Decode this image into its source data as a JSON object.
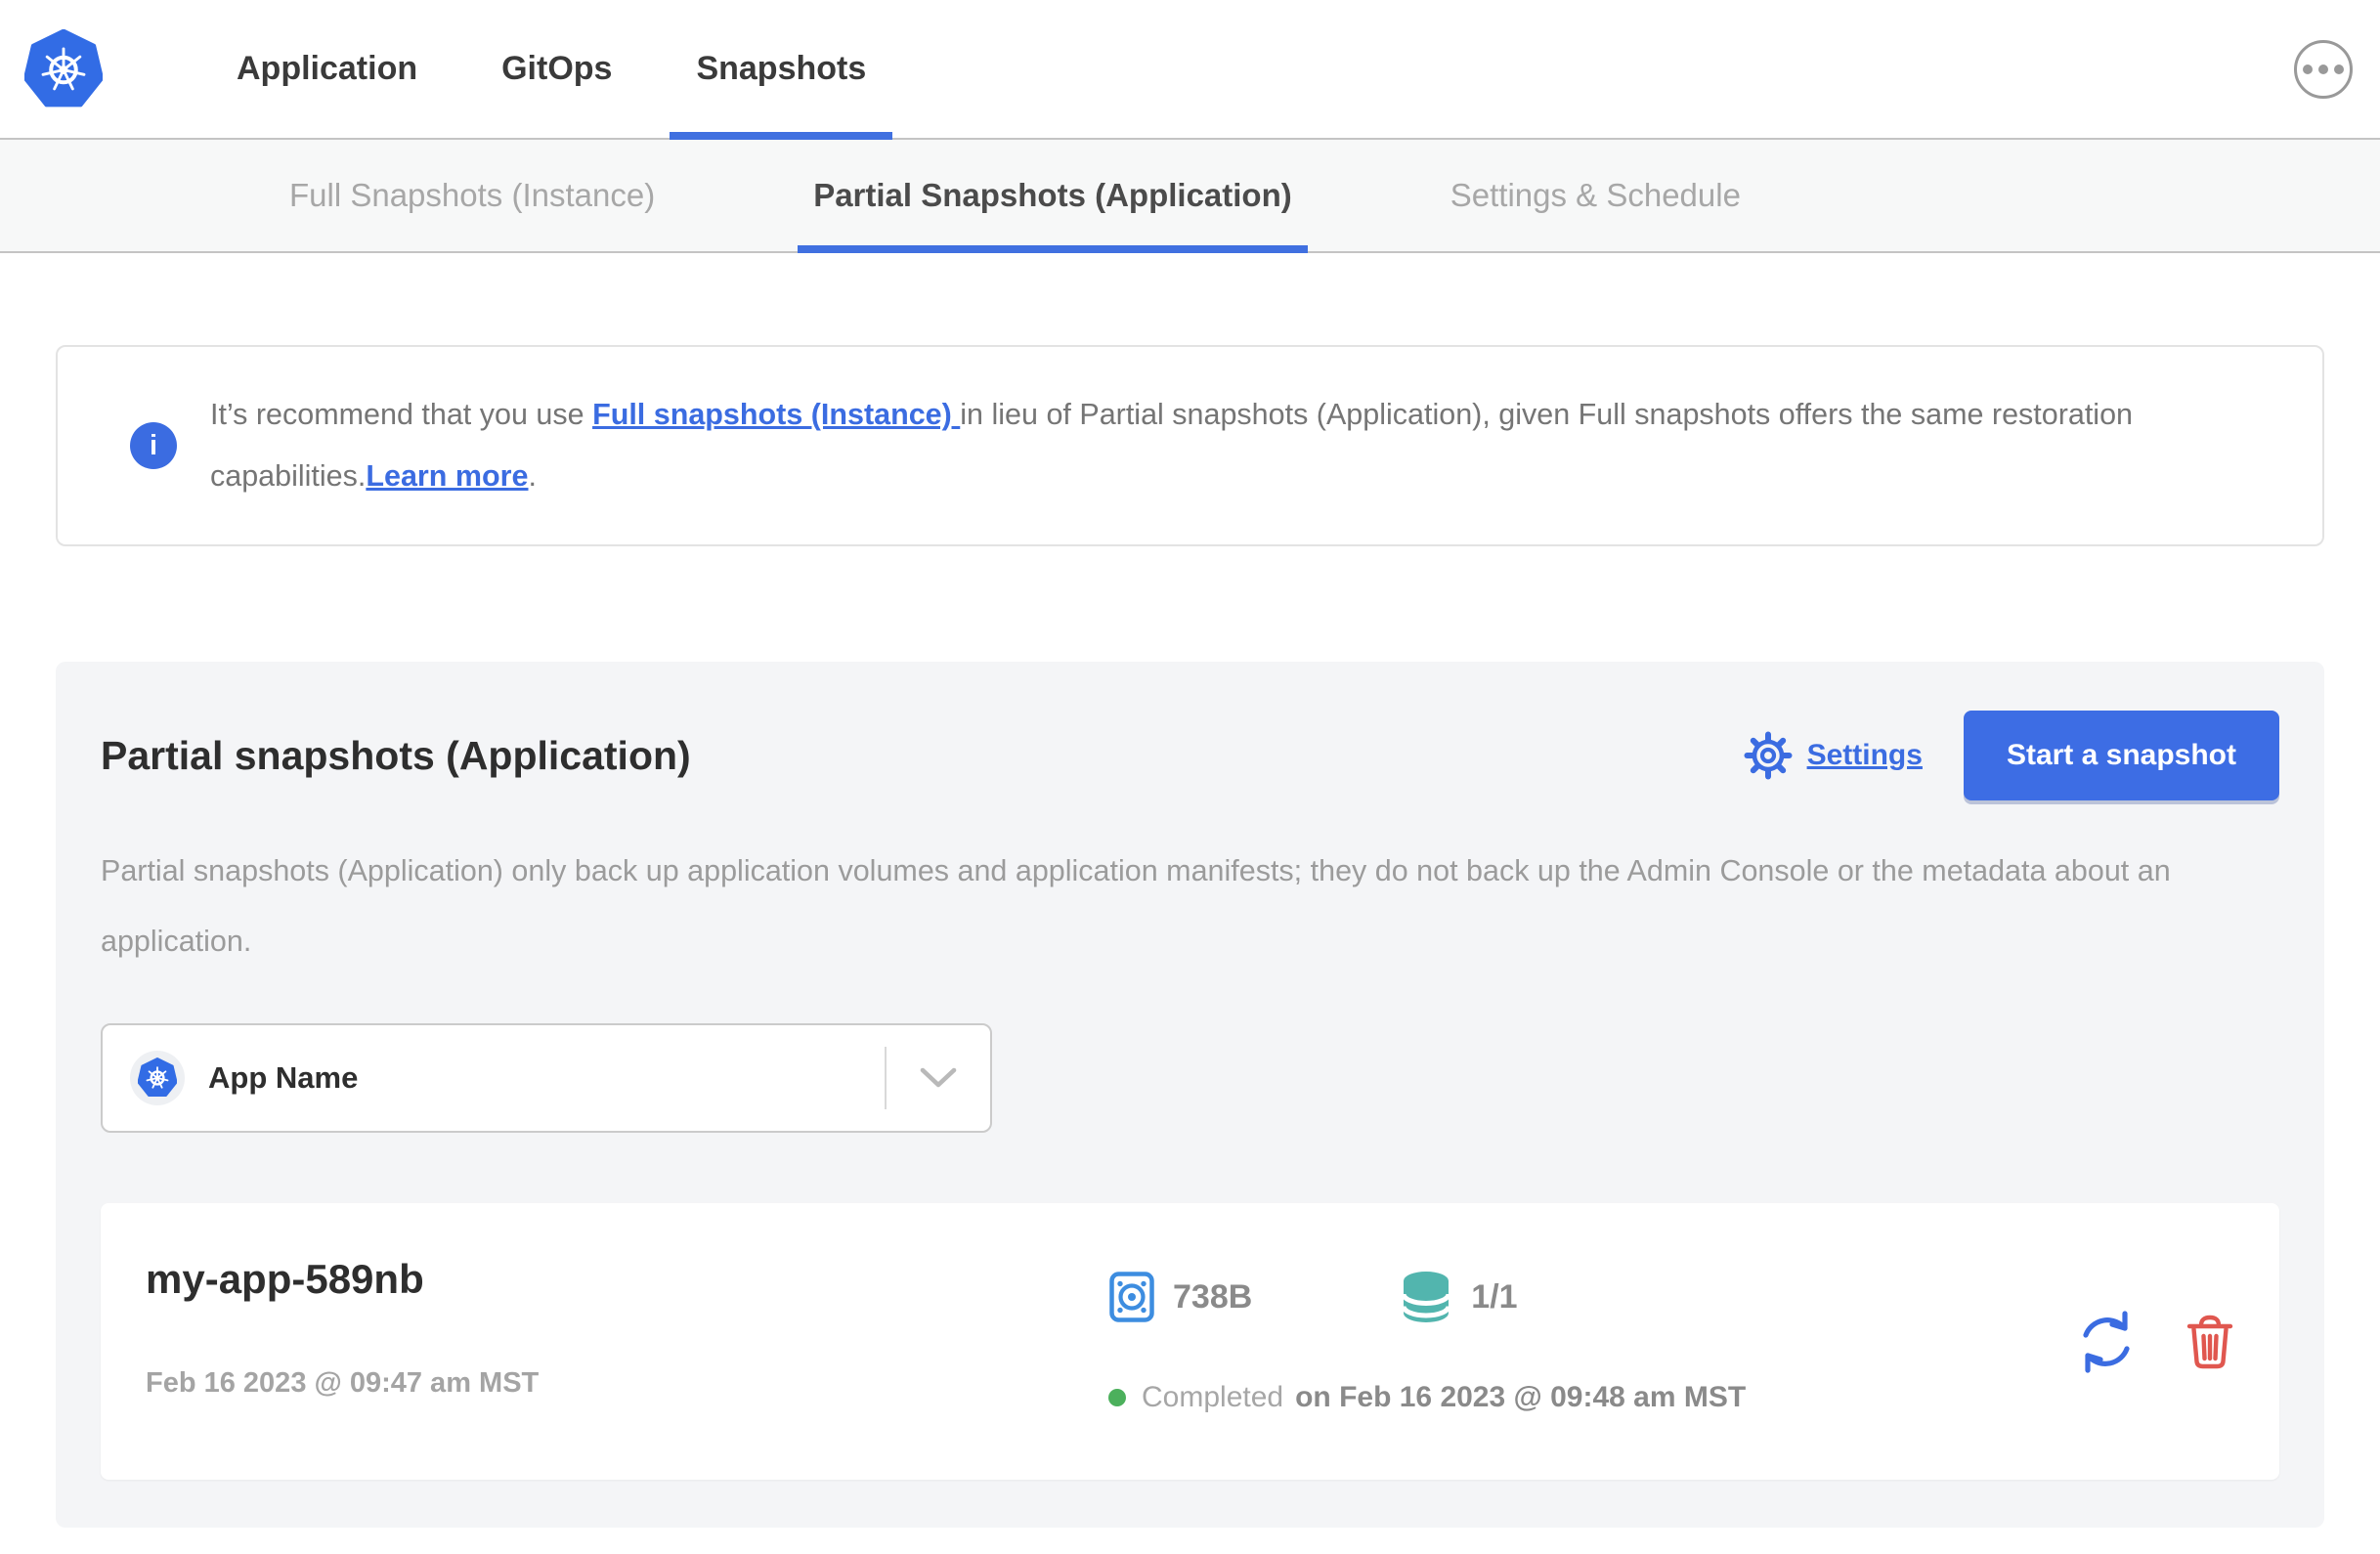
{
  "nav": {
    "items": [
      {
        "label": "Application"
      },
      {
        "label": "GitOps"
      },
      {
        "label": "Snapshots"
      }
    ]
  },
  "subnav": {
    "tabs": [
      {
        "label": "Full Snapshots (Instance)"
      },
      {
        "label": "Partial Snapshots (Application)"
      },
      {
        "label": "Settings & Schedule"
      }
    ]
  },
  "banner": {
    "text1": "It’s recommend that you use ",
    "link1": "Full snapshots (Instance) ",
    "text2": "in lieu of Partial snapshots (Application), given Full snapshots offers the same restoration capabilities.",
    "link2": "Learn more",
    "text3": "."
  },
  "main": {
    "title": "Partial snapshots (Application)",
    "settings_label": "Settings",
    "start_button_label": "Start a snapshot",
    "description": "Partial snapshots (Application) only back up application volumes and application manifests; they do not back up the Admin Console or the metadata about an application.",
    "app_selector": {
      "value": "App Name"
    },
    "snapshots": [
      {
        "name": "my-app-589nb",
        "created": "Feb 16 2023 @ 09:47 am MST",
        "size": "738B",
        "volumes": "1/1",
        "status": "Completed",
        "finished": "on Feb 16 2023 @ 09:48 am MST"
      }
    ]
  },
  "colors": {
    "accent_blue": "#3b6ce1",
    "button_blue": "#3d6de4",
    "k8s_blue": "#326ce5",
    "disk_blue": "#3d8de0",
    "teal": "#52b5ae",
    "red": "#e0574f",
    "green": "#4cb05c"
  }
}
